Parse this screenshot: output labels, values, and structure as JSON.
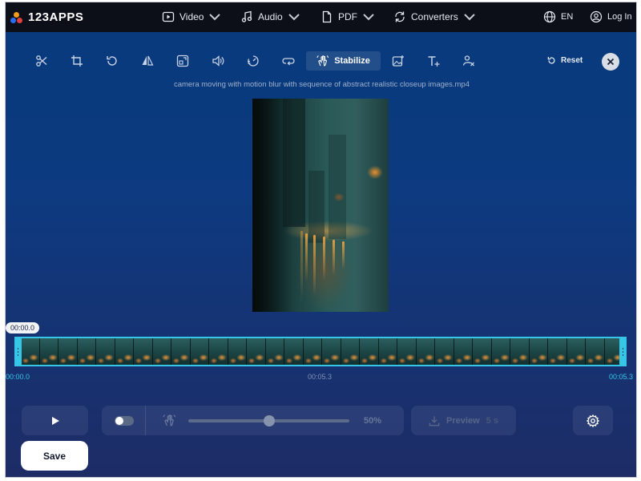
{
  "header": {
    "logo": "123APPS",
    "nav": [
      {
        "label": "Video",
        "icon": "video-icon"
      },
      {
        "label": "Audio",
        "icon": "music-note-icon"
      },
      {
        "label": "PDF",
        "icon": "document-icon"
      },
      {
        "label": "Converters",
        "icon": "convert-icon"
      }
    ],
    "language": "EN",
    "login": "Log In"
  },
  "toolbar": {
    "tools": [
      {
        "name": "cut",
        "icon": "scissors-icon"
      },
      {
        "name": "crop",
        "icon": "crop-icon"
      },
      {
        "name": "rotate",
        "icon": "rotate-icon"
      },
      {
        "name": "flip",
        "icon": "flip-icon"
      },
      {
        "name": "resize",
        "icon": "resize-icon"
      },
      {
        "name": "volume",
        "icon": "speaker-icon"
      },
      {
        "name": "speed",
        "icon": "speed-icon"
      },
      {
        "name": "loop",
        "icon": "loop-icon"
      },
      {
        "name": "stabilize",
        "icon": "stabilize-hand-icon",
        "label": "Stabilize",
        "active": true
      },
      {
        "name": "add-image",
        "icon": "image-add-icon"
      },
      {
        "name": "add-text",
        "icon": "text-add-icon"
      },
      {
        "name": "remove-logo",
        "icon": "remove-logo-icon"
      }
    ],
    "reset_label": "Reset"
  },
  "video": {
    "filename": "camera moving with motion blur with sequence of abstract realistic closeup images.mp4"
  },
  "timeline": {
    "current_time": "00:00.0",
    "start_label": "00:00.0",
    "mid_label": "00:05.3",
    "end_label": "00:05.3",
    "accent_color": "#36c6e8"
  },
  "controls": {
    "stabilize_enabled": false,
    "stabilize_strength": "50%",
    "stabilize_strength_value": 0.5,
    "preview_label": "Preview",
    "preview_duration": "5 s",
    "save_label": "Save"
  }
}
